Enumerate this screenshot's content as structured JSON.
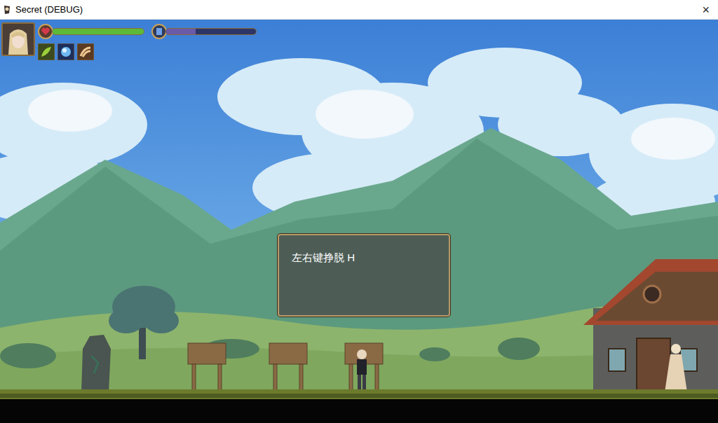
{
  "window": {
    "title": "Secret (DEBUG)",
    "close": "×"
  },
  "hud": {
    "health": {
      "level": 1.0
    },
    "mana": {
      "level": 0.33
    }
  },
  "dialog": {
    "text": "左右键挣脱 H"
  }
}
